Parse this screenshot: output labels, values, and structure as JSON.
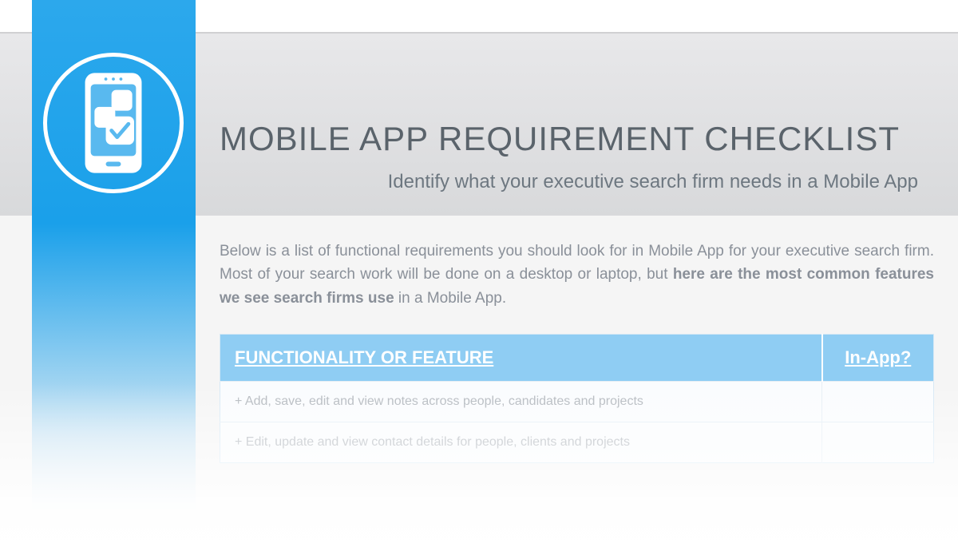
{
  "header": {
    "title": "MOBILE APP REQUIREMENT CHECKLIST",
    "subtitle": "Identify what your executive search firm needs in a Mobile App"
  },
  "intro": {
    "part1": "Below is a list of functional requirements you should look for in Mobile App for your executive search firm. Most of your search work will be done on a desktop or laptop, but ",
    "bold": "here are the most common features we see search firms use",
    "part2": " in a Mobile App."
  },
  "table": {
    "col1": "FUNCTIONALITY OR FEATURE",
    "col2": "In-App?",
    "rows": [
      {
        "feature": "+ Add, save, edit and view notes across people, candidates and projects",
        "inapp": ""
      },
      {
        "feature": "+ Edit, update and view contact details for people, clients and projects",
        "inapp": ""
      }
    ]
  },
  "icon_name": "mobile-apps-icon"
}
